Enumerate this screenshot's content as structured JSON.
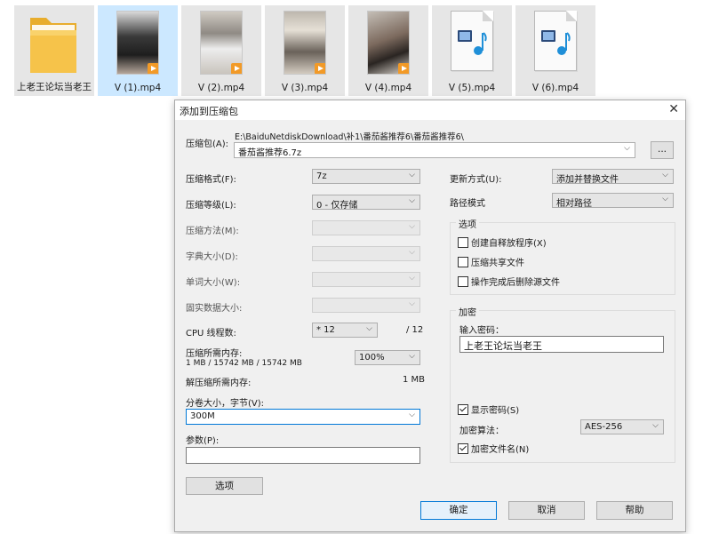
{
  "files": [
    {
      "name": "上老王论坛当老王",
      "kind": "folder"
    },
    {
      "name": "V (1).mp4",
      "kind": "video"
    },
    {
      "name": "V (2).mp4",
      "kind": "video"
    },
    {
      "name": "V (3).mp4",
      "kind": "video"
    },
    {
      "name": "V (4).mp4",
      "kind": "video"
    },
    {
      "name": "V (5).mp4",
      "kind": "media"
    },
    {
      "name": "V (6).mp4",
      "kind": "media"
    }
  ],
  "dialog": {
    "title": "添加到压缩包",
    "close_icon": "close-icon",
    "archive_label": "压缩包(A):",
    "archive_path": "E:\\BaiduNetdiskDownload\\补1\\番茄酱推荐6\\番茄酱推荐6\\",
    "archive_name": "番茄酱推荐6.7z",
    "browse_label": "...",
    "format_label": "压缩格式(F):",
    "format_value": "7z",
    "level_label": "压缩等级(L):",
    "level_value": "0 - 仅存储",
    "method_label": "压缩方法(M):",
    "dict_label": "字典大小(D):",
    "word_label": "单词大小(W):",
    "solid_label": "固实数据大小:",
    "cpu_label": "CPU 线程数:",
    "cpu_value": "* 12",
    "cpu_max": "/ 12",
    "mem_label": "压缩所需内存:",
    "mem_value": "1 MB / 15742 MB / 15742 MB",
    "mem_percent": "100%",
    "decomp_label": "解压缩所需内存:",
    "decomp_value": "1 MB",
    "volume_label": "分卷大小，字节(V):",
    "volume_value": "300M",
    "params_label": "参数(P):",
    "params_value": "",
    "options_button": "选项",
    "update_label": "更新方式(U):",
    "update_value": "添加并替换文件",
    "path_label": "路径模式",
    "path_value": "相对路径",
    "options_group": "选项",
    "opt_sfx": "创建自释放程序(X)",
    "opt_shared": "压缩共享文件",
    "opt_delete": "操作完成后删除源文件",
    "encrypt_group": "加密",
    "password_label": "输入密码：",
    "password_value": "上老王论坛当老王",
    "show_password": "显示密码(S)",
    "algo_label": "加密算法：",
    "algo_value": "AES-256",
    "encrypt_names": "加密文件名(N)",
    "ok_button": "确定",
    "cancel_button": "取消",
    "help_button": "帮助"
  },
  "colors": {
    "accent": "#0078d7",
    "selected_bg": "#cce8ff",
    "folder": "#f6c34a",
    "badge": "#f29a27"
  }
}
